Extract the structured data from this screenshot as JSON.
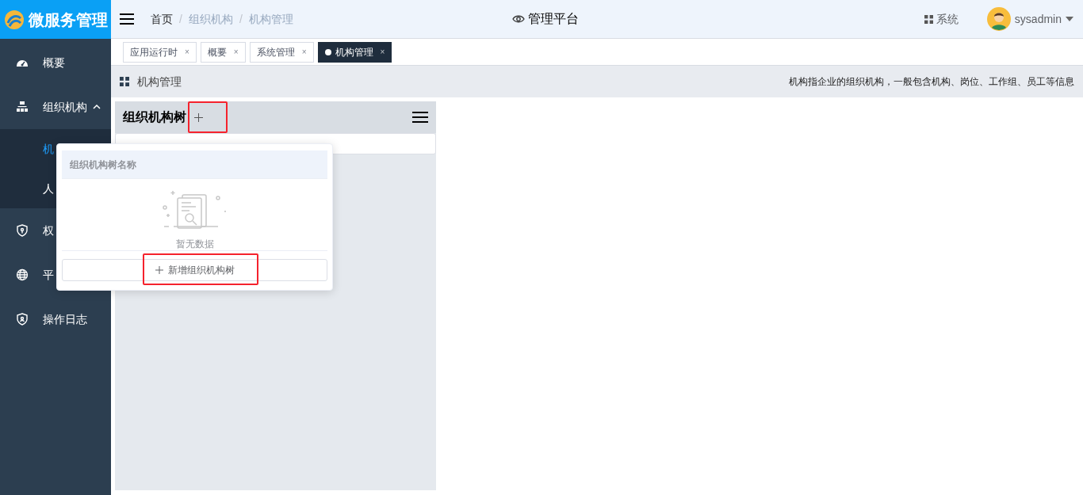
{
  "logo": {
    "title": "微服务管理"
  },
  "sidebar": {
    "items": [
      {
        "label": "概要"
      },
      {
        "label": "组织机构",
        "expanded": true,
        "children": [
          {
            "label": "机",
            "selected": true
          },
          {
            "label": "人",
            "selected": false
          }
        ]
      },
      {
        "label": "权"
      },
      {
        "label": "平"
      },
      {
        "label": "操作日志"
      }
    ]
  },
  "breadcrumb": {
    "separator": "/",
    "items": [
      "首页",
      "组织机构",
      "机构管理"
    ]
  },
  "header": {
    "platform": "管理平台",
    "system": "系统",
    "user": "sysadmin"
  },
  "tabs": [
    {
      "label": "应用运行时",
      "close": "×",
      "selected": false
    },
    {
      "label": "概要",
      "close": "×",
      "selected": false
    },
    {
      "label": "系统管理",
      "close": "×",
      "selected": false
    },
    {
      "label": "机构管理",
      "close": "×",
      "selected": true
    }
  ],
  "page": {
    "title": "机构管理",
    "description": "机构指企业的组织机构，一般包含机构、岗位、工作组、员工等信息"
  },
  "tree_panel": {
    "title": "组织机构树",
    "add_highlighted": true
  },
  "popup": {
    "column": "组织机构树名称",
    "empty_text": "暂无数据",
    "button": "新增组织机构树",
    "button_highlighted": true
  }
}
